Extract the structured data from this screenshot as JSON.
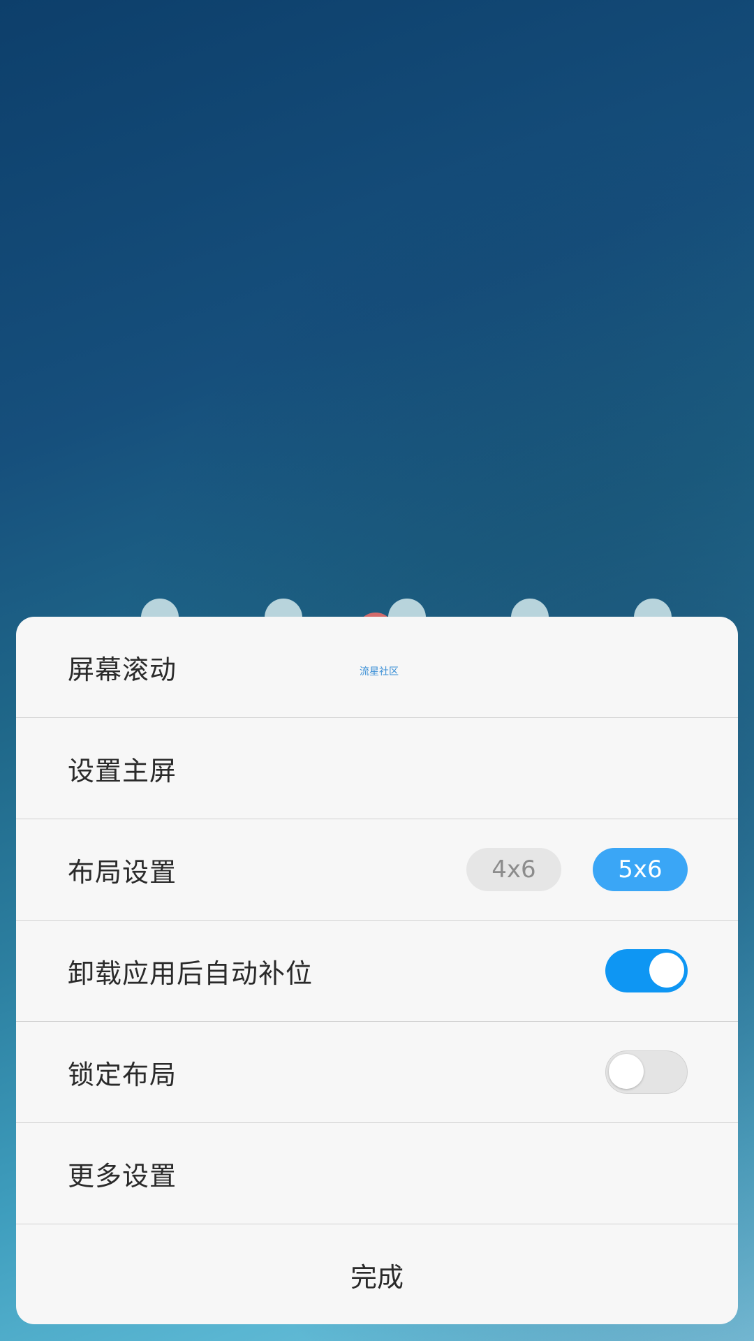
{
  "background": {
    "accent_top": "#0d3f6b",
    "accent_bottom": "#7cc3dc"
  },
  "menu": {
    "items": [
      {
        "label": "屏幕滚动",
        "watermark": "流星社区"
      },
      {
        "label": "设置主屏"
      },
      {
        "label": "布局设置",
        "options": [
          "4x6",
          "5x6"
        ],
        "selected": "5x6"
      },
      {
        "label": "卸载应用后自动补位",
        "toggle": true
      },
      {
        "label": "锁定布局",
        "toggle": false
      },
      {
        "label": "更多设置"
      }
    ],
    "done_label": "完成"
  },
  "colors": {
    "segment_active": "#3aa6f6",
    "toggle_on": "#0e96f3",
    "toggle_off": "#e4e4e4"
  }
}
